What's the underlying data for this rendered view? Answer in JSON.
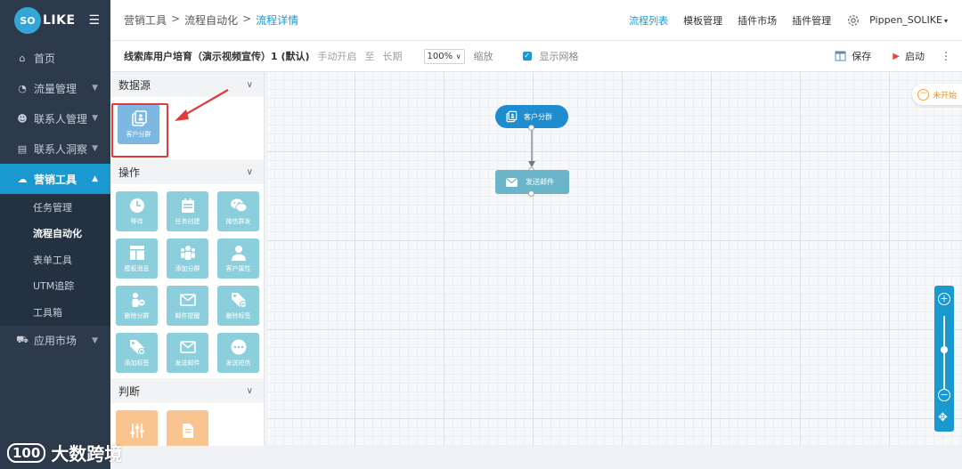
{
  "brand": {
    "logo_circle": "SO",
    "logo_text": "LIKE"
  },
  "sidebar": {
    "items": [
      {
        "label": "首页",
        "icon": "home-icon"
      },
      {
        "label": "流量管理",
        "icon": "pie-chart-icon"
      },
      {
        "label": "联系人管理",
        "icon": "users-icon"
      },
      {
        "label": "联系人洞察",
        "icon": "id-card-icon"
      },
      {
        "label": "营销工具",
        "icon": "cloud-icon"
      },
      {
        "label": "应用市场",
        "icon": "cart-icon"
      }
    ],
    "subitems": [
      "任务管理",
      "流程自动化",
      "表单工具",
      "UTM追踪",
      "工具箱"
    ]
  },
  "breadcrumb": {
    "c1": "营销工具",
    "c2": "流程自动化",
    "c3": "流程详情",
    "sep": ">"
  },
  "toplinks": {
    "l1": "流程列表",
    "l2": "模板管理",
    "l3": "插件市场",
    "l4": "插件管理",
    "user": "Pippen_SOLIKE"
  },
  "toolbar": {
    "flow_name": "线索库用户培育（演示视频宣传）1 (默认)",
    "mode": "手动开启",
    "to": "至",
    "duration": "长期",
    "zoom_value": "100%",
    "zoom_label": "缩放",
    "grid_label": "显示网格",
    "save_label": "保存",
    "start_label": "启动"
  },
  "palette": {
    "sections": {
      "source": "数据源",
      "action": "操作",
      "judge": "判断"
    },
    "source_tiles": [
      "客户分群"
    ],
    "action_tiles": [
      "等待",
      "任务创建",
      "微信群发",
      "模板消息",
      "添加分群",
      "客户属性",
      "删除分群",
      "邮件提醒",
      "删除标签",
      "添加标签",
      "发送邮件",
      "发送短信"
    ]
  },
  "canvas": {
    "node_segment": "客户分群",
    "node_email": "发送邮件",
    "status": "未开始"
  },
  "watermark": {
    "mark": "100",
    "text": "大数跨境"
  },
  "colors": {
    "accent": "#1a99d1",
    "sidebar": "#2d3a4b",
    "tile": "#8ccfdc",
    "judge_tile": "#f9c48f",
    "highlight": "#e03a3a"
  }
}
